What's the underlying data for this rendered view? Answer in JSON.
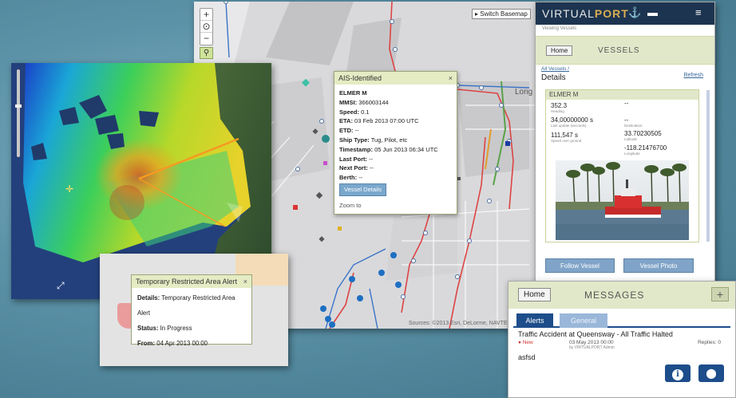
{
  "main_map": {
    "zoom_in": "+",
    "zoom_out": "−",
    "search_icon": "search-icon",
    "switch_basemap": "Switch Basemap",
    "place_label": "Long",
    "attribution": "Sources: ©2013 Esri, DeLorme, NAVTEQ",
    "ais_popup": {
      "title": "AIS-Identified",
      "close": "×",
      "vessel_name": "ELMER M",
      "mmsi_label": "MMSI:",
      "mmsi": "366003144",
      "speed_label": "Speed:",
      "speed": "0.1",
      "eta_label": "ETA:",
      "eta": "03 Feb 2013 07:00 UTC",
      "etd_label": "ETD:",
      "etd": "--",
      "ship_type_label": "Ship Type:",
      "ship_type": "Tug, Pilot, etc",
      "timestamp_label": "Timestamp:",
      "timestamp": "05 Jun 2013 06:34 UTC",
      "last_port_label": "Last Port:",
      "last_port": "--",
      "next_port_label": "Next Port:",
      "next_port": "--",
      "berth_label": "Berth:",
      "berth": "--",
      "vessel_details_button": "Vessel Details",
      "zoom_to": "Zoom to"
    }
  },
  "alert_popup": {
    "title": "Temporary Restricted Area Alert",
    "close": "×",
    "details_label": "Details:",
    "details": "Temporary Restricted Area Alert",
    "status_label": "Status:",
    "status": "In Progress",
    "from_label": "From:",
    "from": "04 Apr 2013 00:00"
  },
  "vessels_panel": {
    "logo_virtual": "VIRTUAL",
    "logo_port": "PORT",
    "crane_icon": "crane-icon",
    "card_icon": "id-card-icon",
    "menu_icon": "≡",
    "subtitle": "Viewing Vessels",
    "home_button": "Home",
    "section_title": "VESSELS",
    "breadcrumb": "All Vessels /",
    "details_heading": "Details",
    "refresh_link": "Refresh",
    "vessel": {
      "name": "ELMER M",
      "stat_1_value": "352.3",
      "stat_1_label": "Heading",
      "stat_2_value": "--",
      "stat_2_label": "",
      "stat_3_value": "34,00000000 s",
      "stat_3_label": "Last update (seconds)",
      "stat_4_value": "--",
      "stat_4_label": "Destination",
      "stat_5_value": "111,547 s",
      "stat_5_label": "Speed over ground",
      "stat_6_value": "33.70230505",
      "stat_6_label": "Latitude",
      "stat_7_value": "-118.21476700",
      "stat_7_label": "Longitude"
    },
    "follow_vessel_button": "Follow Vessel",
    "vessel_photo_button": "Vessel Photo"
  },
  "messages_panel": {
    "home_button": "Home",
    "title": "MESSAGES",
    "add_button": "+",
    "tabs": [
      {
        "label": "Alerts"
      },
      {
        "label": "General"
      }
    ],
    "message": {
      "title": "Traffic Accident at Queensway - All Traffic Halted",
      "status": "New",
      "date": "03 May 2013 00:00",
      "author": "by VIRTUALPORT Admin",
      "replies": "Replies: 0",
      "body": "asfsd"
    },
    "info_icon": "i",
    "location_icon": "location-pin-icon"
  },
  "colors": {
    "header_navy": "#1d3450",
    "accent_gold": "#d9ae52",
    "nav_green": "#e1e8c9",
    "button_blue": "#7fa4c8",
    "tab_blue": "#1d4d8a"
  }
}
